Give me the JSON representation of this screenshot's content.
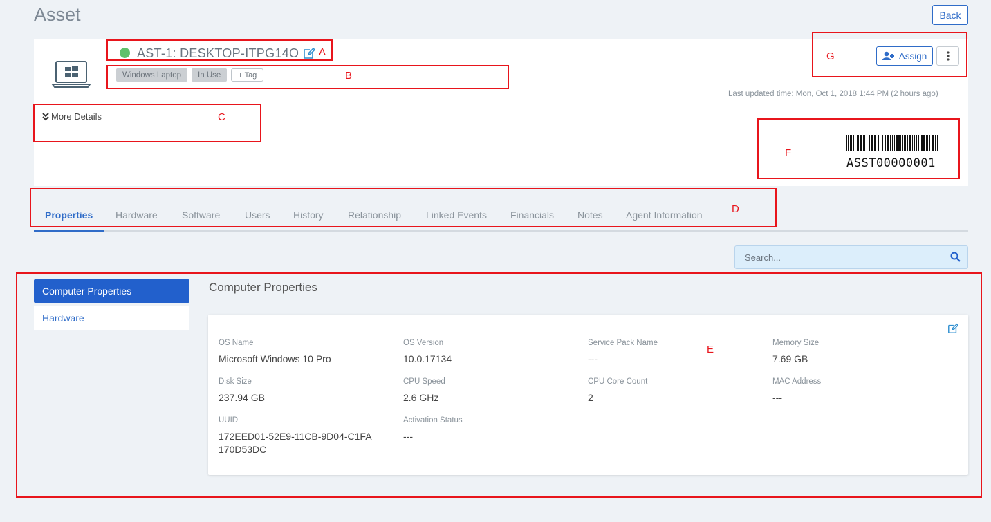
{
  "page": {
    "title": "Asset",
    "back_label": "Back"
  },
  "asset": {
    "name": "AST-1: DESKTOP-ITPG14O",
    "status_color": "#5ec16b",
    "tags": [
      "Windows Laptop",
      "In Use"
    ],
    "add_tag_label": "+ Tag",
    "last_updated": "Last updated time: Mon, Oct 1, 2018 1:44 PM (2 hours ago)",
    "more_details_label": "More Details",
    "barcode_text": "ASST00000001",
    "device_icon": "windows-laptop-icon"
  },
  "actions": {
    "assign_label": "Assign",
    "more_icon": "kebab-icon"
  },
  "tabs": [
    {
      "label": "Properties",
      "active": true
    },
    {
      "label": "Hardware"
    },
    {
      "label": "Software"
    },
    {
      "label": "Users"
    },
    {
      "label": "History"
    },
    {
      "label": "Relationship"
    },
    {
      "label": "Linked Events"
    },
    {
      "label": "Financials"
    },
    {
      "label": "Notes"
    },
    {
      "label": "Agent Information"
    }
  ],
  "search": {
    "placeholder": "Search..."
  },
  "side_nav": [
    {
      "label": "Computer Properties",
      "active": true
    },
    {
      "label": "Hardware"
    }
  ],
  "section": {
    "title": "Computer Properties",
    "properties": [
      {
        "label": "OS Name",
        "value": "Microsoft Windows 10 Pro"
      },
      {
        "label": "OS Version",
        "value": "10.0.17134"
      },
      {
        "label": "Service Pack Name",
        "value": "---"
      },
      {
        "label": "Memory Size",
        "value": "7.69 GB"
      },
      {
        "label": "Disk Size",
        "value": "237.94 GB"
      },
      {
        "label": "CPU Speed",
        "value": "2.6 GHz"
      },
      {
        "label": "CPU Core Count",
        "value": "2"
      },
      {
        "label": "MAC Address",
        "value": "---"
      },
      {
        "label": "UUID",
        "value": "172EED01-52E9-11CB-9D04-C1FA170D53DC"
      },
      {
        "label": "Activation Status",
        "value": "---"
      }
    ]
  },
  "annotations": {
    "a": "A",
    "b": "B",
    "c": "C",
    "d": "D",
    "e": "E",
    "f": "F",
    "g": "G",
    "color": "#e8151c"
  },
  "theme": {
    "accent": "#2f6cc8",
    "active_nav": "#2260cc",
    "background": "#eef2f6"
  }
}
